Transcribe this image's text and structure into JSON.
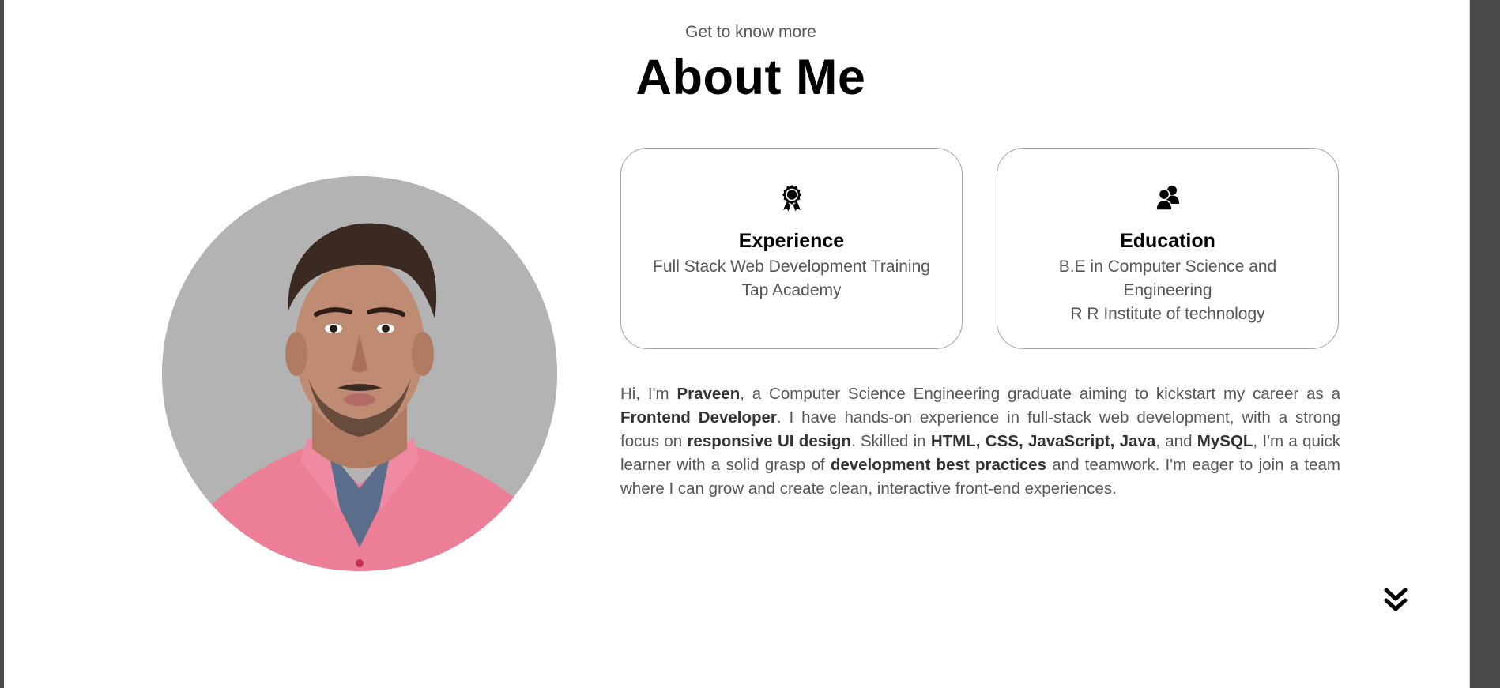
{
  "header": {
    "subtitle": "Get to know more",
    "title": "About Me"
  },
  "profile": {
    "photo": "profile-photo"
  },
  "cards": {
    "experience": {
      "icon": "award-icon",
      "title": "Experience",
      "lines": [
        "Full Stack Web Development Training",
        "Tap Academy"
      ]
    },
    "education": {
      "icon": "users-icon",
      "title": "Education",
      "lines": [
        "B.E in Computer Science and",
        "Engineering",
        "R R Institute of technology"
      ]
    }
  },
  "bio": {
    "segments": [
      {
        "text": "Hi, I'm ",
        "bold": false
      },
      {
        "text": "Praveen",
        "bold": true
      },
      {
        "text": ", a Computer Science Engineering graduate aiming to kickstart my career as a ",
        "bold": false
      },
      {
        "text": "Frontend Developer",
        "bold": true
      },
      {
        "text": ". I have hands-on experience in full-stack web development, with a strong focus on ",
        "bold": false
      },
      {
        "text": "responsive UI design",
        "bold": true
      },
      {
        "text": ". Skilled in ",
        "bold": false
      },
      {
        "text": "HTML, CSS, JavaScript, Java",
        "bold": true
      },
      {
        "text": ", and ",
        "bold": false
      },
      {
        "text": "MySQL",
        "bold": true
      },
      {
        "text": ", I'm a quick learner with a solid grasp of ",
        "bold": false
      },
      {
        "text": "development best practices",
        "bold": true
      },
      {
        "text": " and teamwork. I'm eager to join a team where I can grow and create clean, interactive front-end experiences.",
        "bold": false
      }
    ]
  },
  "navigation": {
    "scroll_icon": "double-chevron-down-icon"
  },
  "colors": {
    "background": "#ffffff",
    "text": "#555555",
    "heading": "#000000",
    "card_border": "#a3a3a3",
    "photo_background": "#b4b3b4",
    "shirt": "#ec7f97"
  }
}
